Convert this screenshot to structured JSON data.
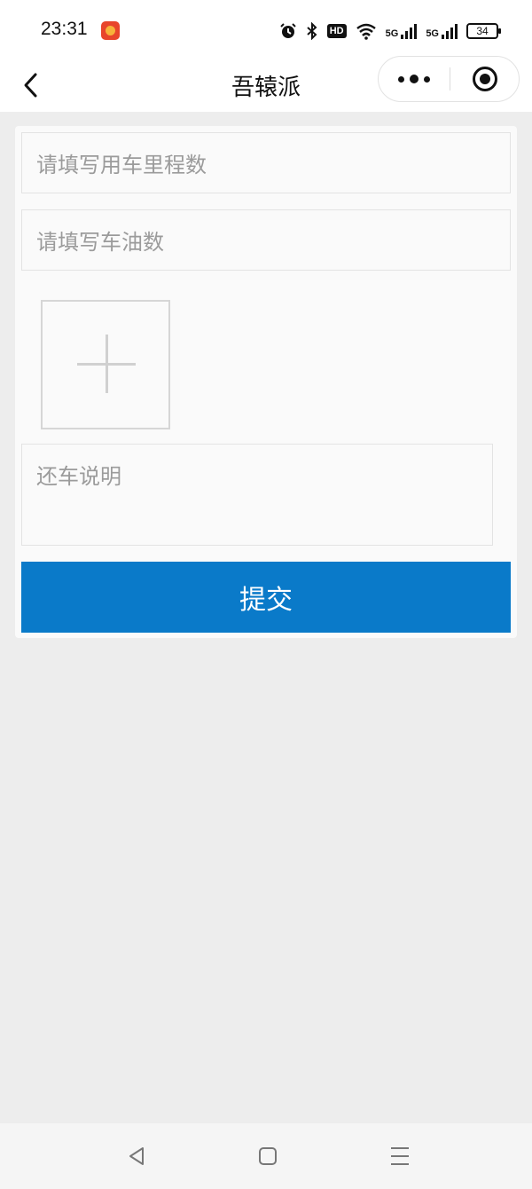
{
  "status_bar": {
    "time": "23:31",
    "app_badge_icon": "app-logo-icon",
    "hd_label": "HD",
    "signal1_label": "5G",
    "signal2_label": "5G",
    "battery_level": "34"
  },
  "nav": {
    "title": "吾辕派",
    "back_icon": "chevron-left-icon",
    "more_icon": "more-dots-icon",
    "close_icon": "target-icon"
  },
  "form": {
    "mileage_placeholder": "请填写用车里程数",
    "fuel_placeholder": "请填写车油数",
    "upload_icon": "plus-icon",
    "note_placeholder": "还车说明",
    "submit_label": "提交"
  },
  "colors": {
    "primary": "#0a7ac9",
    "background": "#ededed",
    "placeholder": "#9b9b9b"
  },
  "system_nav": {
    "back_icon": "triangle-back-icon",
    "home_icon": "square-home-icon",
    "menu_icon": "menu-lines-icon"
  }
}
